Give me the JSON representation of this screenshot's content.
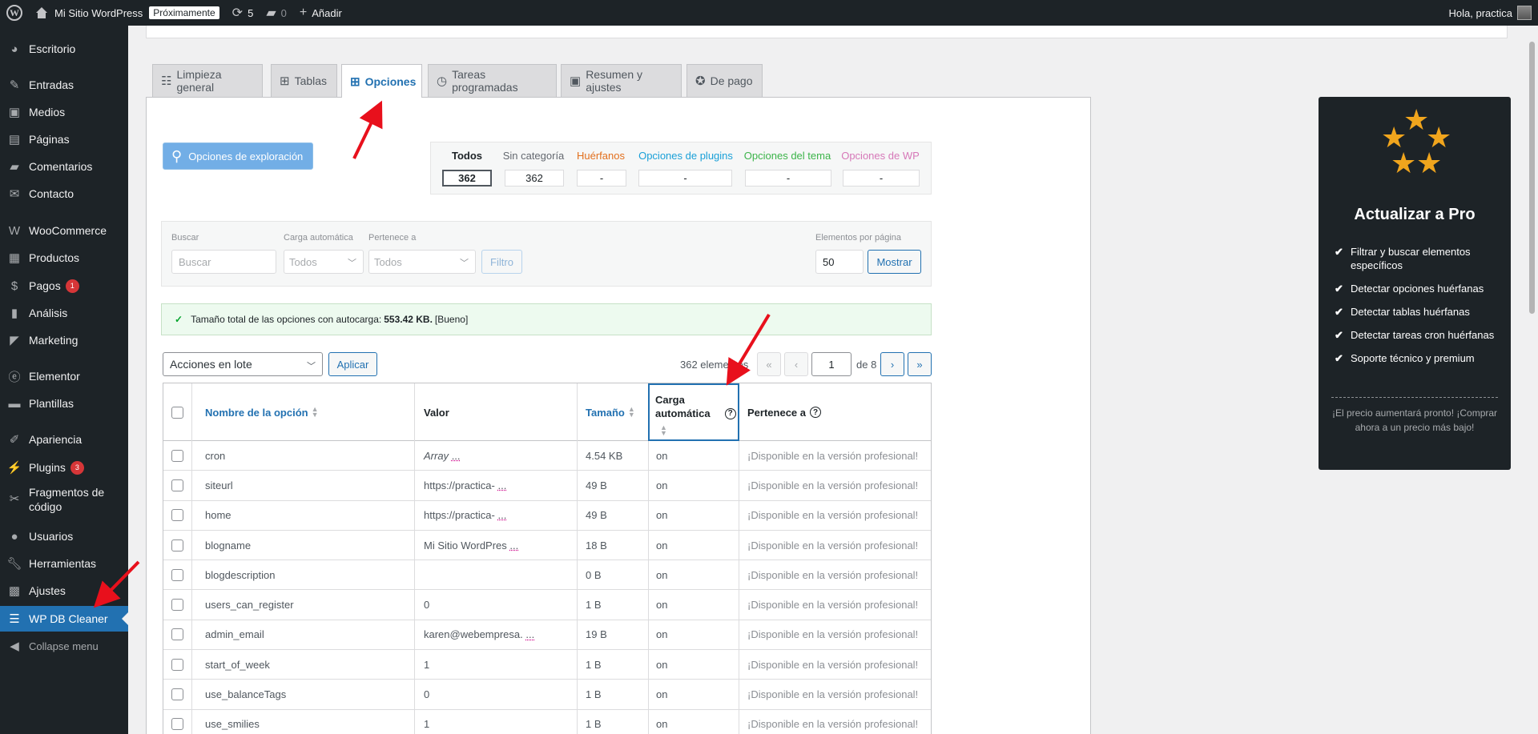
{
  "adminbar": {
    "site_name": "Mi Sitio WordPress",
    "coming_soon": "Próximamente",
    "updates_count": "5",
    "comments_count": "0",
    "add_new": "Añadir",
    "greeting": "Hola, practica"
  },
  "sidebar": {
    "items": [
      {
        "label": "Escritorio",
        "icon": "dashboard-icon"
      },
      {
        "label": "Entradas",
        "icon": "pin-icon"
      },
      {
        "label": "Medios",
        "icon": "media-icon"
      },
      {
        "label": "Páginas",
        "icon": "pages-icon"
      },
      {
        "label": "Comentarios",
        "icon": "comments-icon"
      },
      {
        "label": "Contacto",
        "icon": "mail-icon"
      },
      {
        "label": "WooCommerce",
        "icon": "woo-icon"
      },
      {
        "label": "Productos",
        "icon": "products-icon"
      },
      {
        "label": "Pagos",
        "icon": "payments-icon",
        "badge": "1"
      },
      {
        "label": "Análisis",
        "icon": "chart-icon"
      },
      {
        "label": "Marketing",
        "icon": "megaphone-icon"
      },
      {
        "label": "Elementor",
        "icon": "elementor-icon"
      },
      {
        "label": "Plantillas",
        "icon": "folder-icon"
      },
      {
        "label": "Apariencia",
        "icon": "brush-icon"
      },
      {
        "label": "Plugins",
        "icon": "plugin-icon",
        "badge": "3"
      },
      {
        "label": "Fragmentos de código",
        "icon": "scissors-icon"
      },
      {
        "label": "Usuarios",
        "icon": "users-icon"
      },
      {
        "label": "Herramientas",
        "icon": "wrench-icon"
      },
      {
        "label": "Ajustes",
        "icon": "settings-icon"
      },
      {
        "label": "WP DB Cleaner",
        "icon": "database-icon"
      },
      {
        "label": "Collapse menu",
        "icon": "collapse-icon"
      }
    ]
  },
  "tabs": [
    {
      "label": "Limpieza general",
      "icon": "broom-icon"
    },
    {
      "label": "Tablas",
      "icon": "table-icon"
    },
    {
      "label": "Opciones",
      "icon": "options-icon"
    },
    {
      "label": "Tareas programadas",
      "icon": "clock-icon"
    },
    {
      "label": "Resumen y ajustes",
      "icon": "summary-icon"
    },
    {
      "label": "De pago",
      "icon": "award-icon"
    }
  ],
  "explore_button": "Opciones de exploración",
  "counts": [
    {
      "label": "Todos",
      "value": "362",
      "color": "#1d2327"
    },
    {
      "label": "Sin categoría",
      "value": "362",
      "color": "#646970"
    },
    {
      "label": "Huérfanos",
      "value": "-",
      "color": "#e26f1d"
    },
    {
      "label": "Opciones de plugins",
      "value": "-",
      "color": "#1aa0d8"
    },
    {
      "label": "Opciones del tema",
      "value": "-",
      "color": "#3cb44a"
    },
    {
      "label": "Opciones de WP",
      "value": "-",
      "color": "#d678b8"
    }
  ],
  "filters": {
    "search_label": "Buscar",
    "search_placeholder": "Buscar",
    "autoload_label": "Carga automática",
    "autoload_value": "Todos",
    "belongs_label": "Pertenece a",
    "belongs_value": "Todos",
    "filter_button": "Filtro",
    "per_page_label": "Elementos por página",
    "per_page_value": "50",
    "show_button": "Mostrar"
  },
  "notice": {
    "text": "Tamaño total de las opciones con autocarga: ",
    "size": "553.42 KB.",
    "status": " [Bueno]"
  },
  "bulk": {
    "select_value": "Acciones en lote",
    "apply_button": "Aplicar"
  },
  "pagination": {
    "items_text": "362 elementos",
    "first": "«",
    "prev": "‹",
    "current_page": "1",
    "of_text": "de 8",
    "next": "›",
    "last": "»"
  },
  "table": {
    "headers": {
      "name": "Nombre de la opción",
      "value": "Valor",
      "size": "Tamaño",
      "autoload_line1": "Carga",
      "autoload_line2": "automática",
      "belongs": "Pertenece a"
    },
    "rows": [
      {
        "name": "cron",
        "value": "Array",
        "ellipsis": "...",
        "size": "4.54 KB",
        "autoload": "on",
        "belongs": "¡Disponible en la versión profesional!"
      },
      {
        "name": "siteurl",
        "value": "https://practica-",
        "ellipsis": "...",
        "size": "49 B",
        "autoload": "on",
        "belongs": "¡Disponible en la versión profesional!"
      },
      {
        "name": "home",
        "value": "https://practica-",
        "ellipsis": "...",
        "size": "49 B",
        "autoload": "on",
        "belongs": "¡Disponible en la versión profesional!"
      },
      {
        "name": "blogname",
        "value": "Mi Sitio WordPres",
        "ellipsis": "...",
        "size": "18 B",
        "autoload": "on",
        "belongs": "¡Disponible en la versión profesional!"
      },
      {
        "name": "blogdescription",
        "value": "",
        "ellipsis": "",
        "size": "0 B",
        "autoload": "on",
        "belongs": "¡Disponible en la versión profesional!"
      },
      {
        "name": "users_can_register",
        "value": "0",
        "ellipsis": "",
        "size": "1 B",
        "autoload": "on",
        "belongs": "¡Disponible en la versión profesional!"
      },
      {
        "name": "admin_email",
        "value": "karen@webempresa.",
        "ellipsis": "...",
        "size": "19 B",
        "autoload": "on",
        "belongs": "¡Disponible en la versión profesional!"
      },
      {
        "name": "start_of_week",
        "value": "1",
        "ellipsis": "",
        "size": "1 B",
        "autoload": "on",
        "belongs": "¡Disponible en la versión profesional!"
      },
      {
        "name": "use_balanceTags",
        "value": "0",
        "ellipsis": "",
        "size": "1 B",
        "autoload": "on",
        "belongs": "¡Disponible en la versión profesional!"
      },
      {
        "name": "use_smilies",
        "value": "1",
        "ellipsis": "",
        "size": "1 B",
        "autoload": "on",
        "belongs": "¡Disponible en la versión profesional!"
      }
    ]
  },
  "pro": {
    "title": "Actualizar a Pro",
    "features": [
      "Filtrar y buscar elementos específicos",
      "Detectar opciones huérfanas",
      "Detectar tablas huérfanas",
      "Detectar tareas cron huérfanas",
      "Soporte técnico y premium"
    ],
    "note": "¡El precio aumentará pronto! ¡Comprar ahora a un precio más bajo!"
  },
  "colors": {
    "accent": "#2271b1",
    "admin_dark": "#1d2327",
    "annotation_arrow": "#e8101c",
    "star": "#f0a51d"
  }
}
